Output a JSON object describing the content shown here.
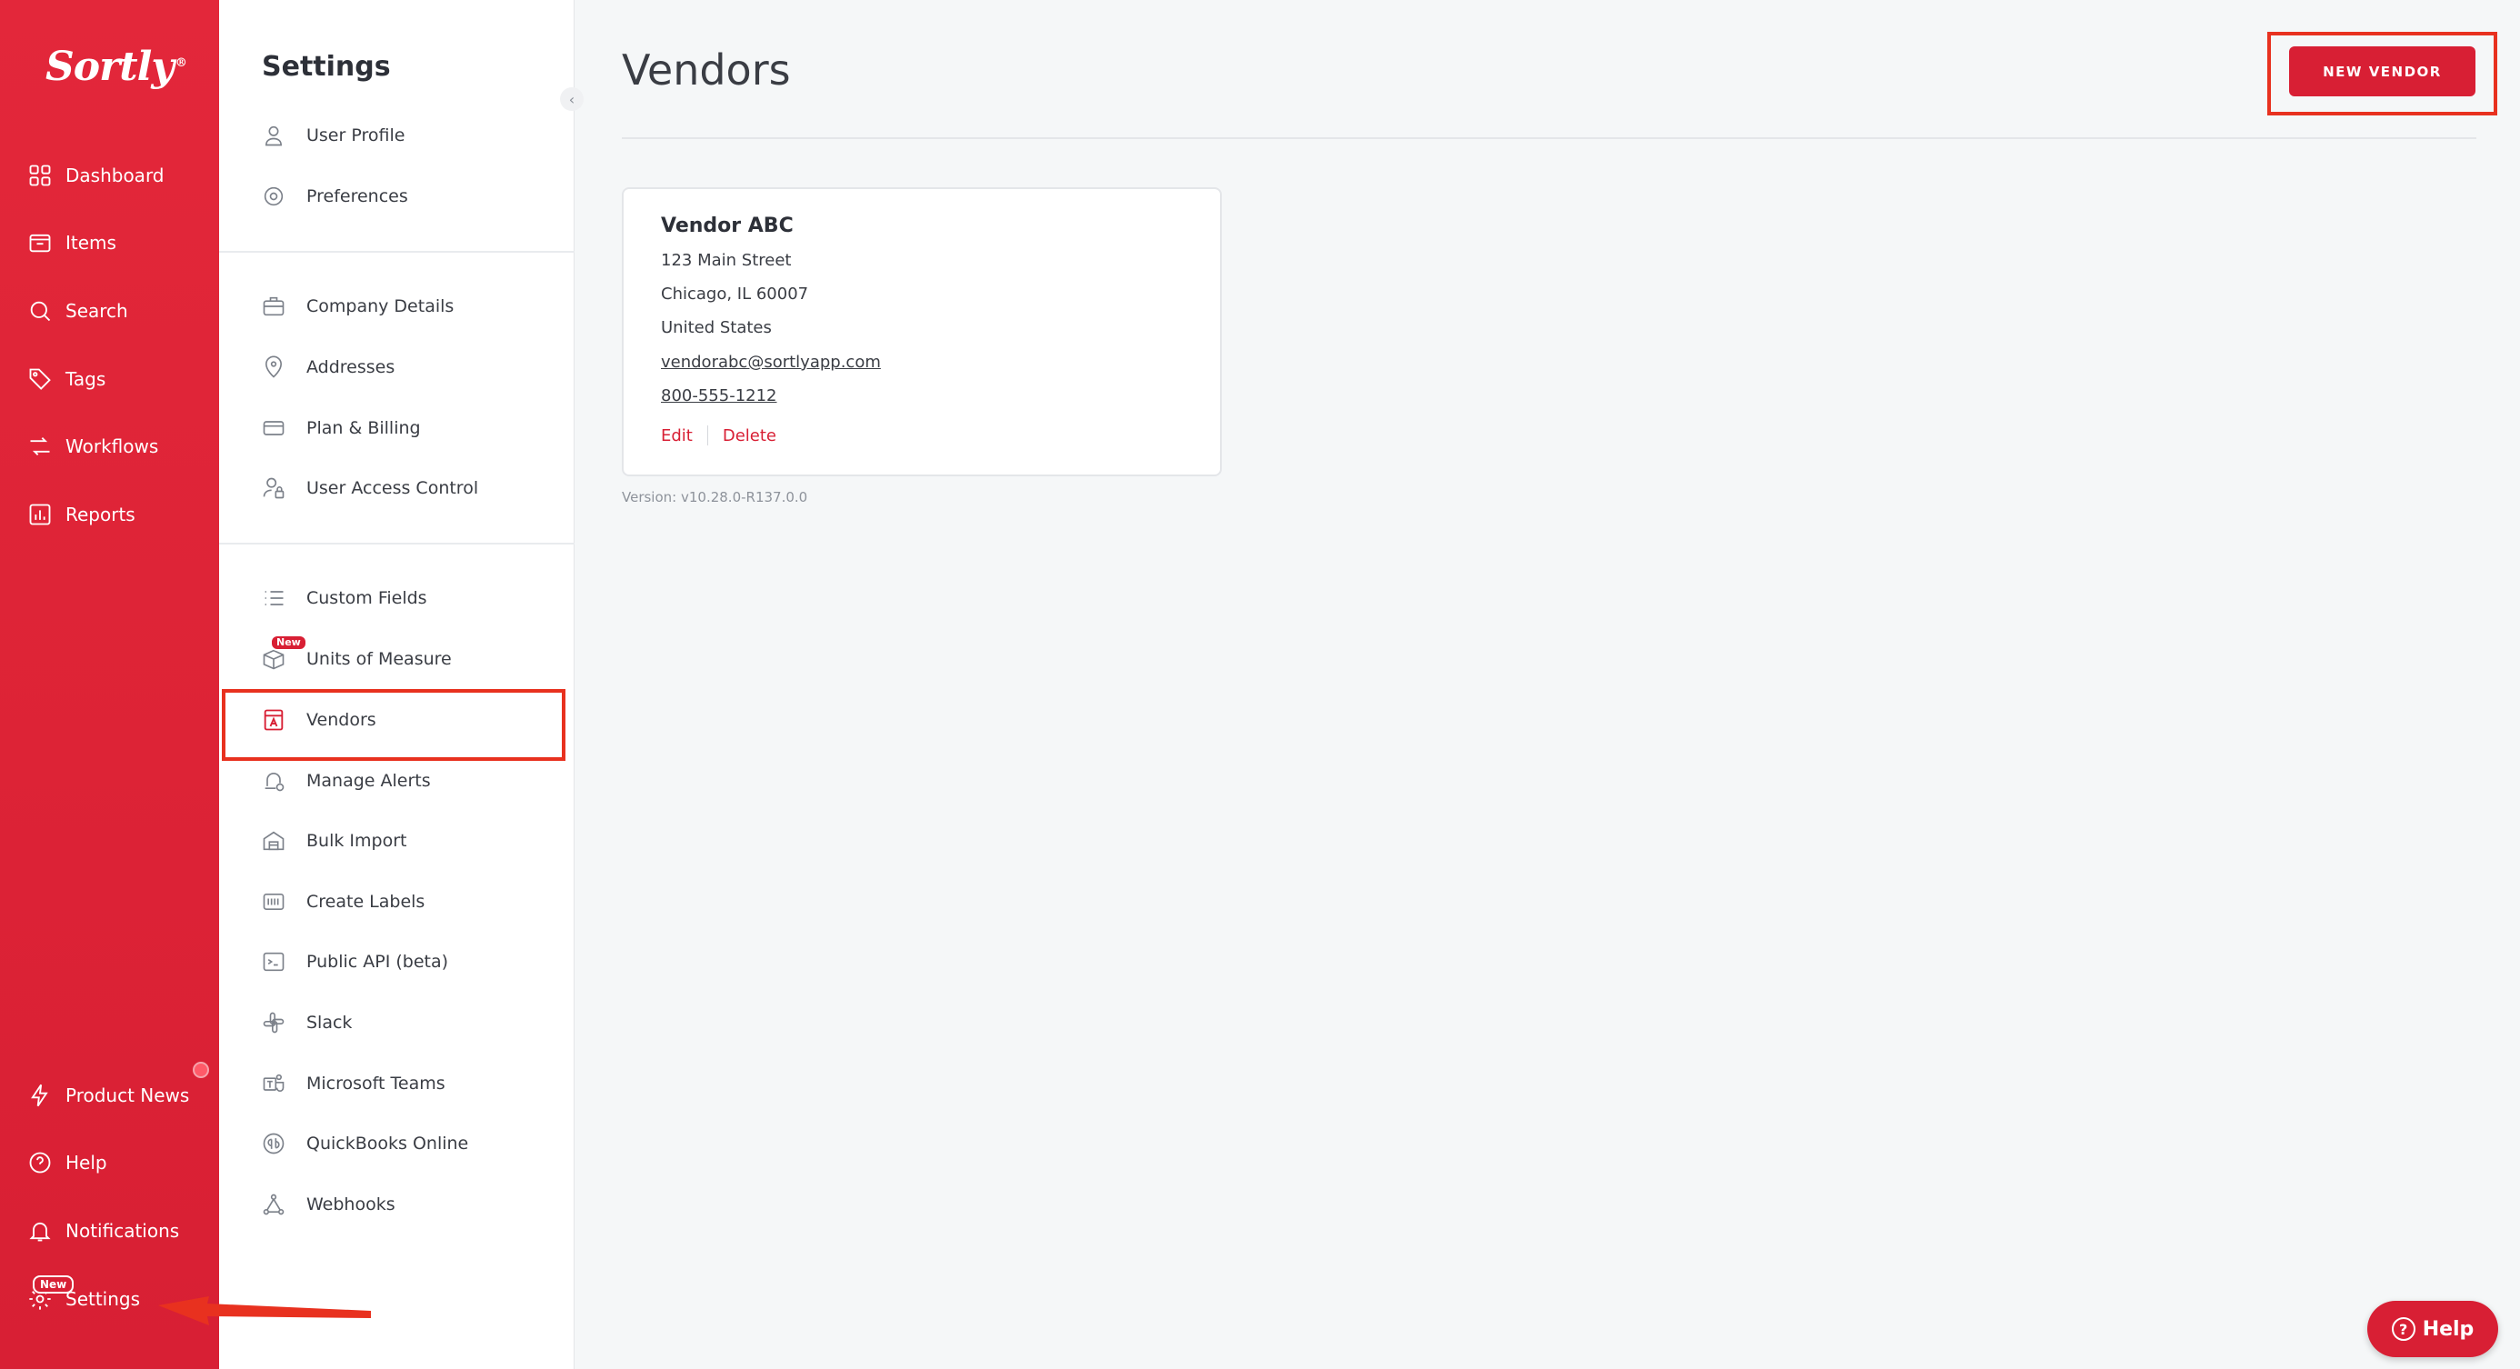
{
  "app": {
    "logo": "Sortly",
    "logo_reg": "®"
  },
  "nav": {
    "items": [
      {
        "label": "Dashboard",
        "icon": "dashboard-icon"
      },
      {
        "label": "Items",
        "icon": "items-icon"
      },
      {
        "label": "Search",
        "icon": "search-icon"
      },
      {
        "label": "Tags",
        "icon": "tag-icon"
      },
      {
        "label": "Workflows",
        "icon": "workflows-icon"
      },
      {
        "label": "Reports",
        "icon": "reports-icon"
      }
    ],
    "bottom": [
      {
        "label": "Product News",
        "icon": "lightning-icon"
      },
      {
        "label": "Help",
        "icon": "help-icon"
      },
      {
        "label": "Notifications",
        "icon": "bell-icon"
      },
      {
        "label": "Settings",
        "icon": "gear-icon",
        "badge": "New"
      }
    ]
  },
  "settings": {
    "title": "Settings",
    "groups": [
      [
        {
          "label": "User Profile",
          "icon": "user-icon"
        },
        {
          "label": "Preferences",
          "icon": "gear-icon"
        }
      ],
      [
        {
          "label": "Company Details",
          "icon": "briefcase-icon"
        },
        {
          "label": "Addresses",
          "icon": "location-pin-icon"
        },
        {
          "label": "Plan & Billing",
          "icon": "credit-card-icon"
        },
        {
          "label": "User Access Control",
          "icon": "user-lock-icon"
        }
      ],
      [
        {
          "label": "Custom Fields",
          "icon": "list-icon"
        },
        {
          "label": "Units of Measure",
          "icon": "measure-box-icon",
          "badge": "New"
        },
        {
          "label": "Vendors",
          "icon": "vendor-store-icon",
          "active": true
        },
        {
          "label": "Manage Alerts",
          "icon": "alert-bell-icon"
        },
        {
          "label": "Bulk Import",
          "icon": "bulk-import-icon"
        },
        {
          "label": "Create Labels",
          "icon": "barcode-label-icon"
        },
        {
          "label": "Public API (beta)",
          "icon": "terminal-icon"
        },
        {
          "label": "Slack",
          "icon": "slack-icon"
        },
        {
          "label": "Microsoft Teams",
          "icon": "teams-icon"
        },
        {
          "label": "QuickBooks Online",
          "icon": "quickbooks-icon"
        },
        {
          "label": "Webhooks",
          "icon": "webhook-icon"
        }
      ]
    ]
  },
  "main": {
    "title": "Vendors",
    "new_vendor_label": "NEW VENDOR",
    "vendor": {
      "name": "Vendor ABC",
      "street": "123 Main Street",
      "city": "Chicago, IL 60007",
      "country": "United States",
      "email": "vendorabc@sortlyapp.com",
      "phone": "800-555-1212",
      "edit_label": "Edit",
      "delete_label": "Delete"
    },
    "version": "Version: v10.28.0-R137.0.0"
  },
  "help_fab": {
    "label": "Help"
  },
  "colors": {
    "brand_red": "#d81f34",
    "annotation_red": "#e8311f"
  }
}
